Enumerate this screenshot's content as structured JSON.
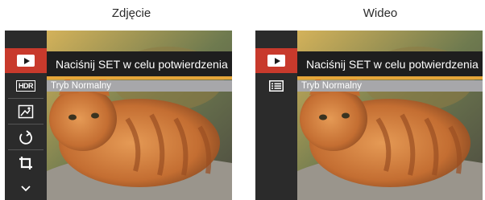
{
  "captions": {
    "left": "Zdjęcie",
    "right": "Wideo"
  },
  "left_screen": {
    "menu_icons": [
      "play-icon",
      "hdr-icon",
      "image-retouch-icon",
      "rotate-icon",
      "crop-icon",
      "chevron-down-icon"
    ],
    "hdr_text": "HDR",
    "prompt": "Naciśnij SET w celu potwierdzenia",
    "mode": "Tryb Normalny",
    "progress": 1.0
  },
  "right_screen": {
    "menu_icons": [
      "play-icon",
      "list-icon"
    ],
    "prompt": "Naciśnij SET w celu potwierdzenia",
    "mode": "Tryb Normalny",
    "progress": 1.0
  },
  "colors": {
    "active": "#c83a2c",
    "progress": "#e5a63a",
    "sidebar": "#2b2b2b"
  }
}
